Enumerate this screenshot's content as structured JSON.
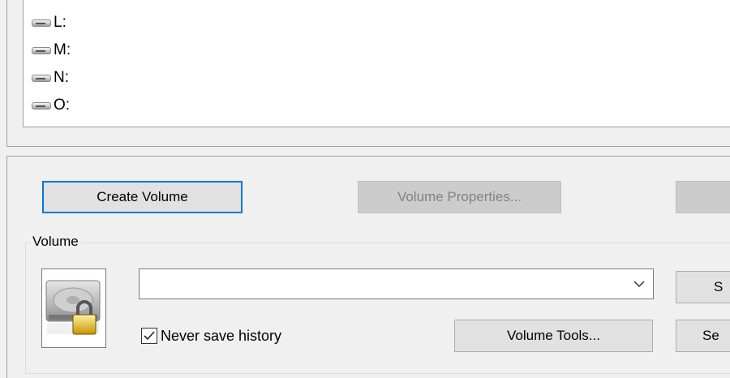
{
  "drive_list": {
    "items": [
      {
        "label": "L:"
      },
      {
        "label": "M:"
      },
      {
        "label": "N:"
      },
      {
        "label": "O:"
      }
    ]
  },
  "buttons": {
    "create_volume": "Create Volume",
    "volume_properties": "Volume Properties...",
    "volume_tools": "Volume Tools...",
    "right_top_partial": "S",
    "right_bottom_partial": "Se"
  },
  "volume_group": {
    "label": "Volume",
    "path_value": "",
    "never_save_history_label": "Never save history",
    "never_save_history_checked": true
  },
  "colors": {
    "focus_accent": "#0078d7",
    "window_bg": "#f0f0f0"
  },
  "icons": {
    "drive": "hard-drive-icon",
    "volume": "locked-drive-icon",
    "dropdown": "chevron-down-icon",
    "check": "checkmark-icon"
  }
}
